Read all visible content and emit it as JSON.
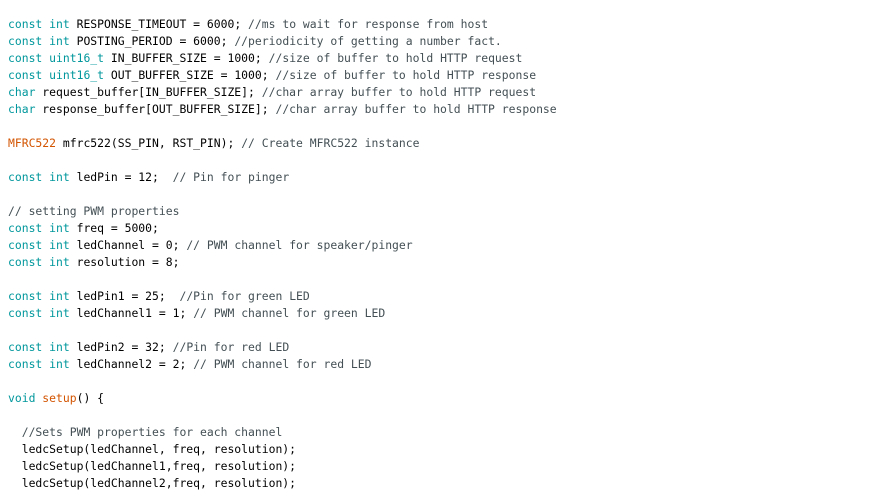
{
  "editor": {
    "lines": [
      [
        {
          "t": "const",
          "c": "kw"
        },
        {
          "t": " "
        },
        {
          "t": "int",
          "c": "kw"
        },
        {
          "t": " RESPONSE_TIMEOUT = 6000; "
        },
        {
          "t": "//ms to wait for response from host",
          "c": "cm"
        }
      ],
      [
        {
          "t": "const",
          "c": "kw"
        },
        {
          "t": " "
        },
        {
          "t": "int",
          "c": "kw"
        },
        {
          "t": " POSTING_PERIOD = 6000; "
        },
        {
          "t": "//periodicity of getting a number fact.",
          "c": "cm"
        }
      ],
      [
        {
          "t": "const",
          "c": "kw"
        },
        {
          "t": " "
        },
        {
          "t": "uint16_t",
          "c": "kw"
        },
        {
          "t": " IN_BUFFER_SIZE = 1000; "
        },
        {
          "t": "//size of buffer to hold HTTP request",
          "c": "cm"
        }
      ],
      [
        {
          "t": "const",
          "c": "kw"
        },
        {
          "t": " "
        },
        {
          "t": "uint16_t",
          "c": "kw"
        },
        {
          "t": " OUT_BUFFER_SIZE = 1000; "
        },
        {
          "t": "//size of buffer to hold HTTP response",
          "c": "cm"
        }
      ],
      [
        {
          "t": "char",
          "c": "kw"
        },
        {
          "t": " request_buffer[IN_BUFFER_SIZE]; "
        },
        {
          "t": "//char array buffer to hold HTTP request",
          "c": "cm"
        }
      ],
      [
        {
          "t": "char",
          "c": "kw"
        },
        {
          "t": " response_buffer[OUT_BUFFER_SIZE]; "
        },
        {
          "t": "//char array buffer to hold HTTP response",
          "c": "cm"
        }
      ],
      [],
      [
        {
          "t": "MFRC522",
          "c": "type-red"
        },
        {
          "t": " mfrc522(SS_PIN, RST_PIN); "
        },
        {
          "t": "// Create MFRC522 instance",
          "c": "cm"
        }
      ],
      [],
      [
        {
          "t": "const",
          "c": "kw"
        },
        {
          "t": " "
        },
        {
          "t": "int",
          "c": "kw"
        },
        {
          "t": " ledPin = 12;  "
        },
        {
          "t": "// Pin for pinger",
          "c": "cm"
        }
      ],
      [],
      [
        {
          "t": "// setting PWM properties",
          "c": "cm"
        }
      ],
      [
        {
          "t": "const",
          "c": "kw"
        },
        {
          "t": " "
        },
        {
          "t": "int",
          "c": "kw"
        },
        {
          "t": " freq = 5000;"
        }
      ],
      [
        {
          "t": "const",
          "c": "kw"
        },
        {
          "t": " "
        },
        {
          "t": "int",
          "c": "kw"
        },
        {
          "t": " ledChannel = 0; "
        },
        {
          "t": "// PWM channel for speaker/pinger",
          "c": "cm"
        }
      ],
      [
        {
          "t": "const",
          "c": "kw"
        },
        {
          "t": " "
        },
        {
          "t": "int",
          "c": "kw"
        },
        {
          "t": " resolution = 8;"
        }
      ],
      [],
      [
        {
          "t": "const",
          "c": "kw"
        },
        {
          "t": " "
        },
        {
          "t": "int",
          "c": "kw"
        },
        {
          "t": " ledPin1 = 25;  "
        },
        {
          "t": "//Pin for green LED",
          "c": "cm"
        }
      ],
      [
        {
          "t": "const",
          "c": "kw"
        },
        {
          "t": " "
        },
        {
          "t": "int",
          "c": "kw"
        },
        {
          "t": " ledChannel1 = 1; "
        },
        {
          "t": "// PWM channel for green LED",
          "c": "cm"
        }
      ],
      [],
      [
        {
          "t": "const",
          "c": "kw"
        },
        {
          "t": " "
        },
        {
          "t": "int",
          "c": "kw"
        },
        {
          "t": " ledPin2 = 32; "
        },
        {
          "t": "//Pin for red LED",
          "c": "cm"
        }
      ],
      [
        {
          "t": "const",
          "c": "kw"
        },
        {
          "t": " "
        },
        {
          "t": "int",
          "c": "kw"
        },
        {
          "t": " ledChannel2 = 2; "
        },
        {
          "t": "// PWM channel for red LED",
          "c": "cm"
        }
      ],
      [],
      [
        {
          "t": "void",
          "c": "kw"
        },
        {
          "t": " "
        },
        {
          "t": "setup",
          "c": "fn"
        },
        {
          "t": "() {"
        }
      ],
      [],
      [
        {
          "t": "  "
        },
        {
          "t": "//Sets PWM properties for each channel",
          "c": "cm"
        }
      ],
      [
        {
          "t": "  ledcSetup(ledChannel, freq, resolution);"
        }
      ],
      [
        {
          "t": "  ledcSetup(ledChannel1,freq, resolution);"
        }
      ],
      [
        {
          "t": "  ledcSetup(ledChannel2,freq, resolution);"
        }
      ]
    ]
  }
}
